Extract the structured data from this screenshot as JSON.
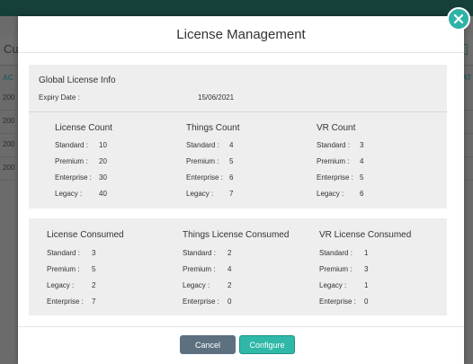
{
  "background": {
    "tab_label": "Cu",
    "col_left": "AC",
    "col_right": "EAT",
    "rows": [
      "200",
      "200",
      "200",
      "200"
    ]
  },
  "modal": {
    "title": "License Management",
    "close_icon": "close-icon",
    "global": {
      "title": "Global License Info",
      "expiry_label": "Expiry Date :",
      "expiry_value": "15/06/2021"
    },
    "counts": [
      {
        "title": "License Count",
        "rows": [
          {
            "label": "Standard :",
            "value": "10"
          },
          {
            "label": "Premium :",
            "value": "20"
          },
          {
            "label": "Enterprise :",
            "value": "30"
          },
          {
            "label": "Legacy :",
            "value": "40"
          }
        ]
      },
      {
        "title": "Things Count",
        "rows": [
          {
            "label": "Standard :",
            "value": "4"
          },
          {
            "label": "Premium :",
            "value": "5"
          },
          {
            "label": "Enterprise :",
            "value": "6"
          },
          {
            "label": "Legacy :",
            "value": "7"
          }
        ]
      },
      {
        "title": "VR Count",
        "rows": [
          {
            "label": "Standard :",
            "value": "3"
          },
          {
            "label": "Premium :",
            "value": "4"
          },
          {
            "label": "Enterprise :",
            "value": "5"
          },
          {
            "label": "Legacy :",
            "value": "6"
          }
        ]
      }
    ],
    "consumed": [
      {
        "title": "License Consumed",
        "rows": [
          {
            "label": "Standard :",
            "value": "3"
          },
          {
            "label": "Premium :",
            "value": "5"
          },
          {
            "label": "Legacy :",
            "value": "2"
          },
          {
            "label": "Enterprise :",
            "value": "7"
          }
        ]
      },
      {
        "title": "Things License Consumed",
        "rows": [
          {
            "label": "Standard :",
            "value": "2"
          },
          {
            "label": "Premium :",
            "value": "4"
          },
          {
            "label": "Legacy :",
            "value": "2"
          },
          {
            "label": "Enterprise :",
            "value": "0"
          }
        ]
      },
      {
        "title": "VR License Consumed",
        "rows": [
          {
            "label": "Standard :",
            "value": "1"
          },
          {
            "label": "Premium :",
            "value": "3"
          },
          {
            "label": "Legacy :",
            "value": "1"
          },
          {
            "label": "Enterprise :",
            "value": "0"
          }
        ]
      }
    ],
    "buttons": {
      "cancel": "Cancel",
      "configure": "Configure"
    }
  }
}
